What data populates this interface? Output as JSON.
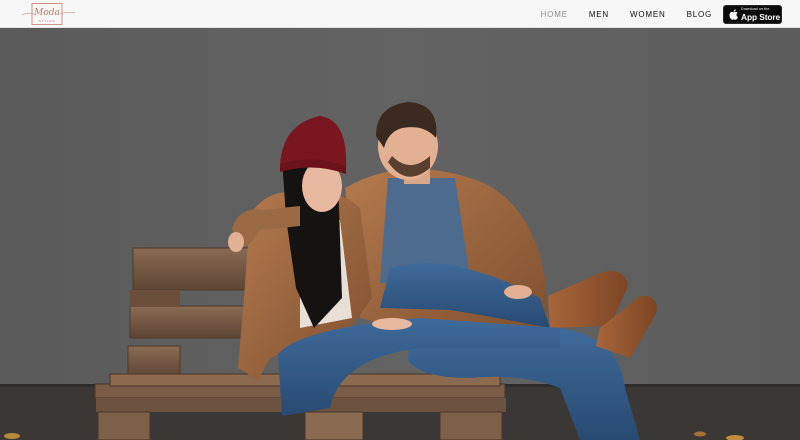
{
  "header": {
    "logo": {
      "text": "Moda",
      "subtext": "STYLES"
    },
    "nav": [
      {
        "label": "HOME",
        "active": true
      },
      {
        "label": "MEN",
        "active": false
      },
      {
        "label": "WOMEN",
        "active": false
      },
      {
        "label": "BLOG",
        "active": false
      }
    ],
    "app_store": {
      "small": "Download on the",
      "big": "App Store",
      "icon": "apple-icon"
    }
  },
  "hero": {
    "image": "couple-sitting-on-wooden-pallet-bench",
    "wall_color": "#5e5e5e",
    "floor_color": "#3b3836"
  },
  "colors": {
    "nav_bg": "#f7f7f7",
    "nav_active": "#8c8c8c",
    "logo_accent": "#c07a6d"
  }
}
